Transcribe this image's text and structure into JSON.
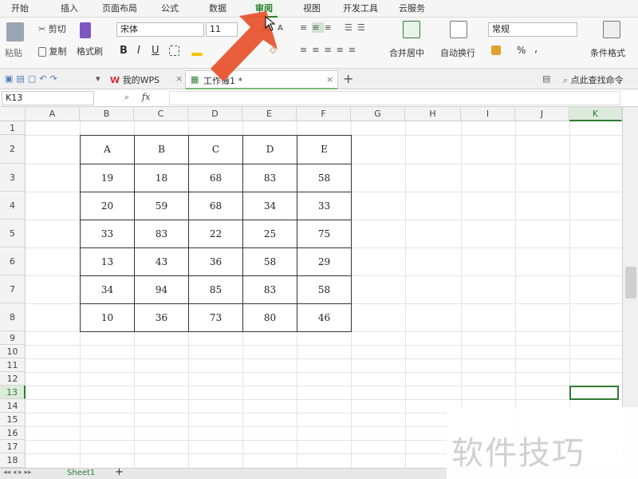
{
  "menu": {
    "tabs": [
      "开始",
      "插入",
      "页面布局",
      "公式",
      "数据",
      "审阅",
      "视图",
      "开发工具",
      "云服务"
    ],
    "active_tab": "审阅"
  },
  "ribbon": {
    "paste": "粘贴",
    "cut": "剪切",
    "copy": "复制",
    "format_painter": "格式刷",
    "font_name": "宋体",
    "font_size": "11",
    "bold": "B",
    "italic": "I",
    "underline": "U",
    "grow_font": "A",
    "shrink_font": "A",
    "merge_center": "合并居中",
    "wrap_text": "自动换行",
    "number_format": "常规",
    "percent": "%",
    "thousands": ",",
    "conditional_format": "条件格式"
  },
  "doc_tabs": {
    "wps_tab": "我的WPS",
    "workbook_tab": "工作簿1 *",
    "search": "点此查找命令"
  },
  "formula_bar": {
    "name_box": "K13",
    "fx_label": "fx",
    "formula": ""
  },
  "grid": {
    "columns": [
      "A",
      "B",
      "C",
      "D",
      "E",
      "F",
      "G",
      "H",
      "I",
      "J",
      "K"
    ],
    "rows": [
      "1",
      "2",
      "3",
      "4",
      "5",
      "6",
      "7",
      "8",
      "9",
      "10",
      "11",
      "12",
      "13",
      "14",
      "15",
      "16",
      "17",
      "18"
    ],
    "selected_cell": "K13",
    "table_headers": [
      "A",
      "B",
      "C",
      "D",
      "E"
    ],
    "table_rows": [
      [
        "19",
        "18",
        "68",
        "83",
        "58"
      ],
      [
        "20",
        "59",
        "68",
        "34",
        "33"
      ],
      [
        "33",
        "83",
        "22",
        "25",
        "75"
      ],
      [
        "13",
        "43",
        "36",
        "58",
        "29"
      ],
      [
        "34",
        "94",
        "85",
        "83",
        "58"
      ],
      [
        "10",
        "36",
        "73",
        "80",
        "46"
      ]
    ]
  },
  "sheets": {
    "sheet1": "Sheet1",
    "add": "+"
  },
  "watermark": "软件技巧",
  "colors": {
    "accent": "#2e7d32",
    "arrow": "#e8552f"
  }
}
